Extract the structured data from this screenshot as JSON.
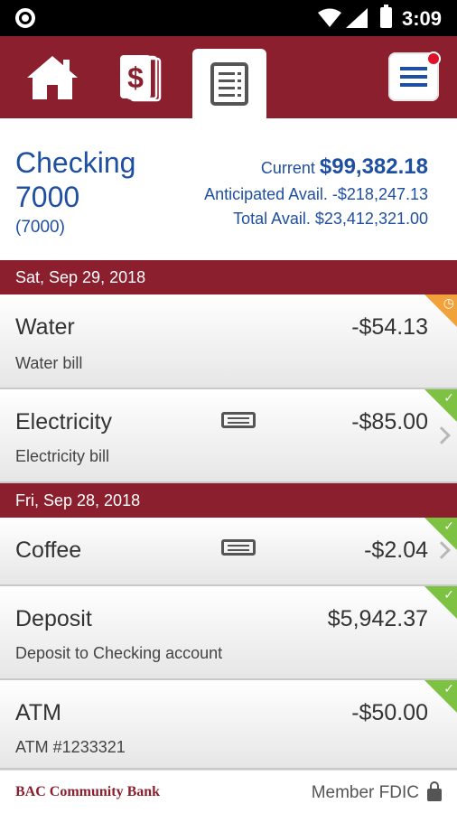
{
  "status_bar": {
    "time": "3:09"
  },
  "nav": {
    "tabs": [
      {
        "name": "home-icon"
      },
      {
        "name": "dollar-doc-icon"
      },
      {
        "name": "document-list-icon",
        "active": true
      }
    ],
    "menu_icon": "hamburger-menu-icon",
    "has_notification": true
  },
  "account": {
    "name": "Checking\n7000",
    "name_line1": "Checking",
    "name_line2": "7000",
    "number": "(7000)",
    "current_label": "Current",
    "current_amount": "$99,382.18",
    "anticipated_label": "Anticipated Avail.",
    "anticipated_amount": "-$218,247.13",
    "total_label": "Total Avail.",
    "total_amount": "$23,412,321.00"
  },
  "groups": [
    {
      "date": "Sat, Sep 29, 2018",
      "transactions": [
        {
          "name": "Water",
          "desc": "Water bill",
          "amount": "-$54.13",
          "status": "pending"
        },
        {
          "name": "Electricity",
          "desc": "Electricity bill",
          "amount": "-$85.00",
          "status": "cleared",
          "has_receipt": true
        }
      ]
    },
    {
      "date": "Fri, Sep 28, 2018",
      "transactions": [
        {
          "name": "Coffee",
          "desc": "",
          "amount": "-$2.04",
          "status": "cleared",
          "has_receipt": true
        },
        {
          "name": "Deposit",
          "desc": "Deposit to Checking account",
          "amount": "$5,942.37",
          "status": "cleared"
        },
        {
          "name": "ATM",
          "desc": "ATM #1233321",
          "amount": "-$50.00",
          "status": "cleared"
        }
      ]
    }
  ],
  "footer": {
    "bank_name": "BAC Community Bank",
    "fdic": "Member FDIC"
  },
  "colors": {
    "brand": "#8b1f2e",
    "accent": "#1f4fa2",
    "pending": "#f2a23a",
    "cleared": "#7dc242"
  }
}
